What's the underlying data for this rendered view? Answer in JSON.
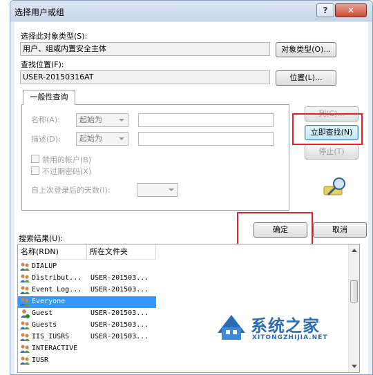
{
  "window": {
    "title": "选择用户或组",
    "help_label": "?",
    "close_label": "✕"
  },
  "object_type": {
    "label": "选择此对象类型(S):",
    "value": "用户、组或内置安全主体",
    "button": "对象类型(O)..."
  },
  "location": {
    "label": "查找位置(F):",
    "value": "USER-20150316AT",
    "button": "位置(L)..."
  },
  "query": {
    "tab_label": "一般性查询",
    "name_label": "名称(A):",
    "name_mode": "起始为",
    "desc_label": "描述(D):",
    "desc_mode": "起始为",
    "disabled_accounts": "禁用的帐户(B)",
    "non_expiring_pw": "不过期密码(X)",
    "days_since_logon": "自上次登录后的天数(I):"
  },
  "side_buttons": {
    "columns": "列(C)...",
    "find_now": "立即查找(N)",
    "stop": "停止(T)"
  },
  "dialog_buttons": {
    "ok": "确定",
    "cancel": "取消"
  },
  "results": {
    "label": "搜索结果(U):",
    "columns": [
      "名称(RDN)",
      "所在文件夹"
    ],
    "rows": [
      {
        "name": "DIALUP",
        "folder": "",
        "selected": false,
        "icon": "group-icon"
      },
      {
        "name": "Distribut...",
        "folder": "USER-201503...",
        "selected": false,
        "icon": "group-icon"
      },
      {
        "name": "Event Log...",
        "folder": "USER-201503...",
        "selected": false,
        "icon": "group-icon"
      },
      {
        "name": "Everyone",
        "folder": "",
        "selected": true,
        "icon": "group-icon"
      },
      {
        "name": "Guest",
        "folder": "USER-201503...",
        "selected": false,
        "icon": "user-icon"
      },
      {
        "name": "Guests",
        "folder": "USER-201503...",
        "selected": false,
        "icon": "group-icon"
      },
      {
        "name": "IIS_IUSRS",
        "folder": "USER-201503...",
        "selected": false,
        "icon": "group-icon"
      },
      {
        "name": "INTERACTIVE",
        "folder": "",
        "selected": false,
        "icon": "group-icon"
      },
      {
        "name": "IUSR",
        "folder": "",
        "selected": false,
        "icon": "group-icon"
      }
    ]
  },
  "watermark": {
    "main": "系统之家",
    "sub": "XITONGZHIJIA.NET"
  },
  "colors": {
    "highlight": "#e1202a",
    "selection": "#3399ff",
    "watermark": "#2b6bb3"
  }
}
